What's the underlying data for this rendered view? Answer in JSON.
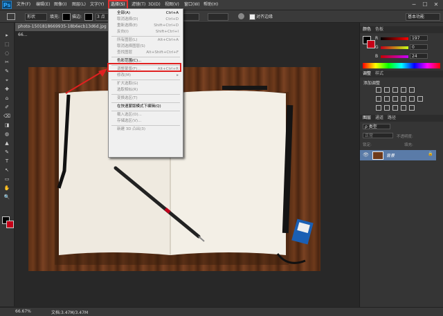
{
  "app": {
    "logo": "Ps"
  },
  "menubar": [
    "文件(F)",
    "编辑(E)",
    "图像(I)",
    "图层(L)",
    "文字(Y)",
    "选择(S)",
    "滤镜(T)",
    "3D(D)",
    "视图(V)",
    "窗口(W)",
    "帮助(H)"
  ],
  "window_controls": {
    "minimize": "─",
    "maximize": "☐",
    "close": "✕"
  },
  "options": {
    "shape_mode": "形状",
    "fill_label": "填充:",
    "stroke_label": "描边:",
    "stroke_width": "3 点",
    "align_edges": "对齐边缘",
    "workspace": "基本功能"
  },
  "document": {
    "tab": "photo-1501818669935-18b6ecb13d6d.jpg @ 66..."
  },
  "status": {
    "zoom": "66.67%",
    "doc_info": "文档:3.47M/3.47M"
  },
  "select_menu": [
    {
      "label": "全部(A)",
      "shortcut": "Ctrl+A",
      "disabled": false
    },
    {
      "label": "取消选择(D)",
      "shortcut": "Ctrl+D",
      "disabled": true
    },
    {
      "label": "重新选择(E)",
      "shortcut": "Shift+Ctrl+D",
      "disabled": true
    },
    {
      "label": "反向(I)",
      "shortcut": "Shift+Ctrl+I",
      "disabled": true
    },
    {
      "sep": true
    },
    {
      "label": "所有图层(L)",
      "shortcut": "Alt+Ctrl+A",
      "disabled": true
    },
    {
      "label": "取消选择图层(S)",
      "shortcut": "",
      "disabled": true
    },
    {
      "label": "查找图层",
      "shortcut": "Alt+Shift+Ctrl+F",
      "disabled": true
    },
    {
      "sep": true
    },
    {
      "label": "色彩范围(C)...",
      "shortcut": "",
      "disabled": false
    },
    {
      "sep": true
    },
    {
      "label": "调整蒙版(F)...",
      "shortcut": "Alt+Ctrl+R",
      "disabled": true
    },
    {
      "label": "修改(M)",
      "shortcut": "▸",
      "disabled": true
    },
    {
      "sep": true
    },
    {
      "label": "扩大选取(G)",
      "shortcut": "",
      "disabled": true
    },
    {
      "label": "选取相似(R)",
      "shortcut": "",
      "disabled": true
    },
    {
      "sep": true
    },
    {
      "label": "变换选区(T)",
      "shortcut": "",
      "disabled": true
    },
    {
      "sep": true
    },
    {
      "label": "在快速蒙版模式下编辑(Q)",
      "shortcut": "",
      "disabled": false
    },
    {
      "sep": true
    },
    {
      "label": "载入选区(O)...",
      "shortcut": "",
      "disabled": true
    },
    {
      "label": "存储选区(V)...",
      "shortcut": "",
      "disabled": true
    },
    {
      "sep": true
    },
    {
      "label": "新建 3D 凸出(3)",
      "shortcut": "",
      "disabled": true
    }
  ],
  "color_panel": {
    "tabs": [
      "颜色",
      "色板"
    ],
    "r": {
      "label": "R",
      "value": "197"
    },
    "g": {
      "label": "G",
      "value": "0"
    },
    "b": {
      "label": "B",
      "value": "24"
    }
  },
  "adjust_panel": {
    "tabs": [
      "调整",
      "样式"
    ],
    "title": "添加调整"
  },
  "layers_panel": {
    "tabs": [
      "图层",
      "通道",
      "路径"
    ],
    "kind": "ρ 类型",
    "blend": "正常",
    "opacity_label": "不透明度:",
    "lock_label": "锁定:",
    "fill_label": "填充:",
    "layer_name": "背景"
  },
  "colors": {
    "accent": "#c50018",
    "menu_highlight": "#e02020"
  }
}
